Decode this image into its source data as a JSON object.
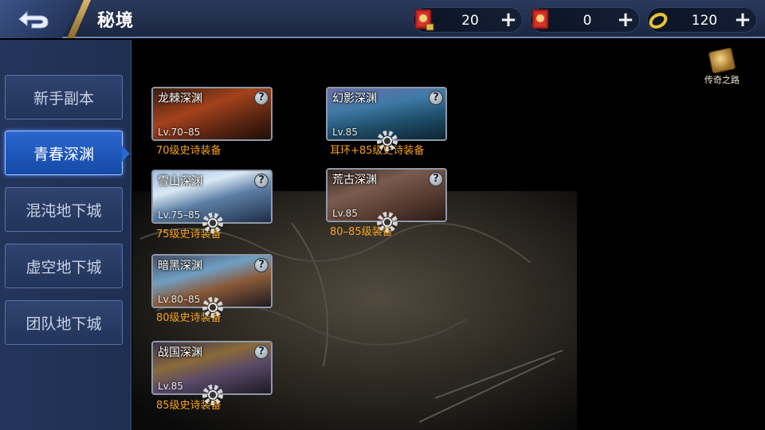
{
  "header": {
    "title": "秘境",
    "currencies": [
      {
        "icon": "locked-ticket-book-icon",
        "value": "20"
      },
      {
        "icon": "ticket-book-icon",
        "value": "0"
      },
      {
        "icon": "gold-ring-icon",
        "value": "120"
      }
    ],
    "plus": "+"
  },
  "sidebar": {
    "tabs": [
      {
        "label": "新手副本",
        "active": false
      },
      {
        "label": "青春深渊",
        "active": true
      },
      {
        "label": "混沌地下城",
        "active": false
      },
      {
        "label": "虚空地下城",
        "active": false
      },
      {
        "label": "团队地下城",
        "active": false
      }
    ]
  },
  "legend_road": {
    "label": "传奇之路"
  },
  "dungeons": [
    {
      "name": "龙棘深渊",
      "level": "Lv.70–85",
      "reward": "70级史诗装备",
      "help": "?"
    },
    {
      "name": "幻影深渊",
      "level": "Lv.85",
      "reward": "耳环+85级史诗装备",
      "help": "?"
    },
    {
      "name": "雪山深渊",
      "level": "Lv.75–85",
      "reward": "75级史诗装备",
      "help": "?"
    },
    {
      "name": "荒古深渊",
      "level": "Lv.85",
      "reward": "80–85级装备",
      "help": "?"
    },
    {
      "name": "暗黑深渊",
      "level": "Lv.80–85",
      "reward": "80级史诗装备",
      "help": "?"
    },
    {
      "name": "战国深渊",
      "level": "Lv.85",
      "reward": "85级史诗装备",
      "help": "?"
    }
  ],
  "colors": {
    "accent_gold": "#d7b66a",
    "tab_active": "#2a67cf",
    "reward_orange": "#f5a21d"
  }
}
